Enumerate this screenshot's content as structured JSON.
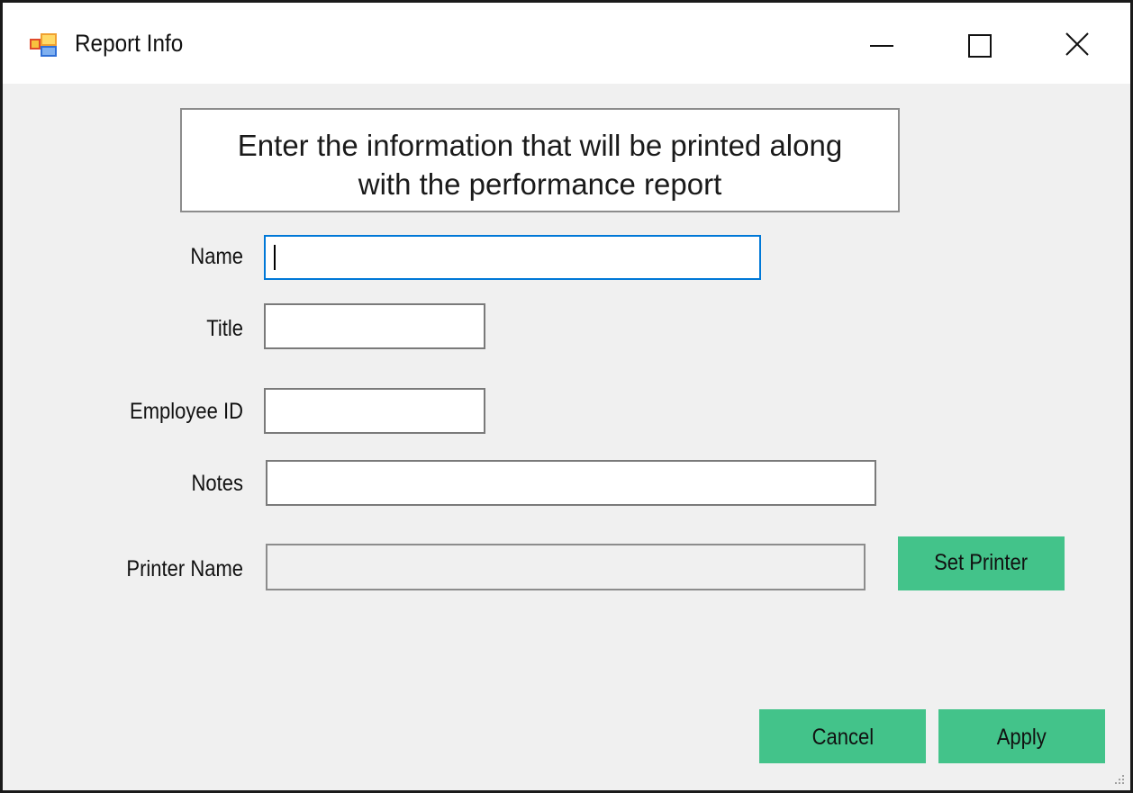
{
  "window": {
    "title": "Report Info",
    "app_icon": "windows-form-icon",
    "controls": {
      "minimize_icon": "minimize-icon",
      "maximize_icon": "maximize-icon",
      "close_icon": "close-icon"
    }
  },
  "banner": {
    "text": "Enter the information that will be printed along\nwith the performance report"
  },
  "form": {
    "name": {
      "label": "Name",
      "value": ""
    },
    "title": {
      "label": "Title",
      "value": ""
    },
    "employee_id": {
      "label": "Employee ID",
      "value": ""
    },
    "notes": {
      "label": "Notes",
      "value": ""
    },
    "printer_name": {
      "label": "Printer Name",
      "value": ""
    }
  },
  "buttons": {
    "set_printer": "Set Printer",
    "cancel": "Cancel",
    "apply": "Apply"
  },
  "colors": {
    "button_green": "#43c38a",
    "focus_blue": "#0078d7",
    "window_bg": "#f0f0f0"
  }
}
